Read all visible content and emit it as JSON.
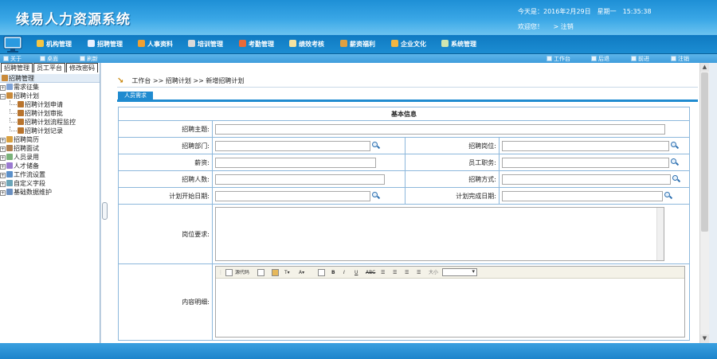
{
  "header": {
    "title": "续易人力资源系统",
    "date": "今天是：2016年2月29日　星期一　15:35:38",
    "welcome": "欢迎您！",
    "logout": "> 注销"
  },
  "nav": [
    {
      "label": "机构管理",
      "color": "#f5c542"
    },
    {
      "label": "招聘管理",
      "color": "#e8f0ff"
    },
    {
      "label": "人事资料",
      "color": "#f0a030"
    },
    {
      "label": "培训管理",
      "color": "#d9d9d9"
    },
    {
      "label": "考勤管理",
      "color": "#e86a3a"
    },
    {
      "label": "绩效考核",
      "color": "#f5e3a0"
    },
    {
      "label": "薪资福利",
      "color": "#e0a040"
    },
    {
      "label": "企业文化",
      "color": "#f3b640"
    },
    {
      "label": "系统管理",
      "color": "#cfe6b0"
    }
  ],
  "subbar": {
    "left": [
      "关于",
      "桌面",
      "刷新"
    ],
    "right": [
      "工作台",
      "后退",
      "前进",
      "注销"
    ]
  },
  "sidebar": {
    "tabs": [
      "招聘管理",
      "员工平台",
      "修改密码"
    ],
    "root": "招聘管理",
    "tree": [
      {
        "label": "需求征集",
        "expanded": false,
        "color": "#7fa3d6"
      },
      {
        "label": "招聘计划",
        "expanded": true,
        "color": "#c98a3a",
        "children": [
          "招聘计划申请",
          "招聘计划审批",
          "招聘计划流程监控",
          "招聘计划记录"
        ]
      },
      {
        "label": "招聘简历",
        "expanded": false,
        "color": "#d9a040"
      },
      {
        "label": "招聘面试",
        "expanded": false,
        "color": "#b08050"
      },
      {
        "label": "人员录用",
        "expanded": false,
        "color": "#7ab27a"
      },
      {
        "label": "人才储备",
        "expanded": false,
        "color": "#9a7ad0"
      },
      {
        "label": "工作流设置",
        "expanded": false,
        "color": "#5a8fc8"
      },
      {
        "label": "自定义字段",
        "expanded": false,
        "color": "#6aa5b8"
      },
      {
        "label": "基础数据维护",
        "expanded": false,
        "color": "#6a8fc0"
      }
    ]
  },
  "content": {
    "breadcrumb": "工作台 >> 招聘计划 >> 新增招聘计划",
    "tab": "人员需求",
    "section_title": "基本信息",
    "fields": {
      "subject": "招聘主题:",
      "department": "招聘部门:",
      "position": "招聘岗位:",
      "salary": "薪资:",
      "duty": "员工职务:",
      "headcount": "招聘人数:",
      "method": "招聘方式:",
      "start_date": "计划开始日期:",
      "end_date": "计划完成日期:",
      "requirements": "岗位要求:",
      "details": "内容明细:"
    },
    "editor": {
      "source_label": "源代码",
      "font_size_label": "大小"
    }
  }
}
